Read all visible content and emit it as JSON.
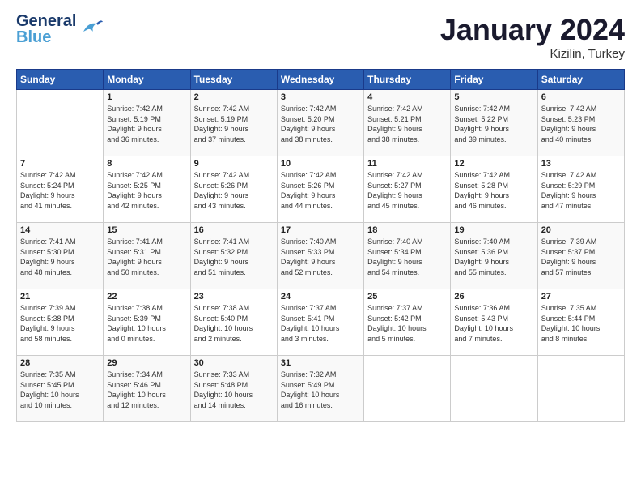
{
  "header": {
    "logo_general": "General",
    "logo_blue": "Blue",
    "month_title": "January 2024",
    "location": "Kizilin, Turkey"
  },
  "columns": [
    "Sunday",
    "Monday",
    "Tuesday",
    "Wednesday",
    "Thursday",
    "Friday",
    "Saturday"
  ],
  "weeks": [
    [
      {
        "day": "",
        "info": ""
      },
      {
        "day": "1",
        "info": "Sunrise: 7:42 AM\nSunset: 5:19 PM\nDaylight: 9 hours\nand 36 minutes."
      },
      {
        "day": "2",
        "info": "Sunrise: 7:42 AM\nSunset: 5:19 PM\nDaylight: 9 hours\nand 37 minutes."
      },
      {
        "day": "3",
        "info": "Sunrise: 7:42 AM\nSunset: 5:20 PM\nDaylight: 9 hours\nand 38 minutes."
      },
      {
        "day": "4",
        "info": "Sunrise: 7:42 AM\nSunset: 5:21 PM\nDaylight: 9 hours\nand 38 minutes."
      },
      {
        "day": "5",
        "info": "Sunrise: 7:42 AM\nSunset: 5:22 PM\nDaylight: 9 hours\nand 39 minutes."
      },
      {
        "day": "6",
        "info": "Sunrise: 7:42 AM\nSunset: 5:23 PM\nDaylight: 9 hours\nand 40 minutes."
      }
    ],
    [
      {
        "day": "7",
        "info": "Sunrise: 7:42 AM\nSunset: 5:24 PM\nDaylight: 9 hours\nand 41 minutes."
      },
      {
        "day": "8",
        "info": "Sunrise: 7:42 AM\nSunset: 5:25 PM\nDaylight: 9 hours\nand 42 minutes."
      },
      {
        "day": "9",
        "info": "Sunrise: 7:42 AM\nSunset: 5:26 PM\nDaylight: 9 hours\nand 43 minutes."
      },
      {
        "day": "10",
        "info": "Sunrise: 7:42 AM\nSunset: 5:26 PM\nDaylight: 9 hours\nand 44 minutes."
      },
      {
        "day": "11",
        "info": "Sunrise: 7:42 AM\nSunset: 5:27 PM\nDaylight: 9 hours\nand 45 minutes."
      },
      {
        "day": "12",
        "info": "Sunrise: 7:42 AM\nSunset: 5:28 PM\nDaylight: 9 hours\nand 46 minutes."
      },
      {
        "day": "13",
        "info": "Sunrise: 7:42 AM\nSunset: 5:29 PM\nDaylight: 9 hours\nand 47 minutes."
      }
    ],
    [
      {
        "day": "14",
        "info": "Sunrise: 7:41 AM\nSunset: 5:30 PM\nDaylight: 9 hours\nand 48 minutes."
      },
      {
        "day": "15",
        "info": "Sunrise: 7:41 AM\nSunset: 5:31 PM\nDaylight: 9 hours\nand 50 minutes."
      },
      {
        "day": "16",
        "info": "Sunrise: 7:41 AM\nSunset: 5:32 PM\nDaylight: 9 hours\nand 51 minutes."
      },
      {
        "day": "17",
        "info": "Sunrise: 7:40 AM\nSunset: 5:33 PM\nDaylight: 9 hours\nand 52 minutes."
      },
      {
        "day": "18",
        "info": "Sunrise: 7:40 AM\nSunset: 5:34 PM\nDaylight: 9 hours\nand 54 minutes."
      },
      {
        "day": "19",
        "info": "Sunrise: 7:40 AM\nSunset: 5:36 PM\nDaylight: 9 hours\nand 55 minutes."
      },
      {
        "day": "20",
        "info": "Sunrise: 7:39 AM\nSunset: 5:37 PM\nDaylight: 9 hours\nand 57 minutes."
      }
    ],
    [
      {
        "day": "21",
        "info": "Sunrise: 7:39 AM\nSunset: 5:38 PM\nDaylight: 9 hours\nand 58 minutes."
      },
      {
        "day": "22",
        "info": "Sunrise: 7:38 AM\nSunset: 5:39 PM\nDaylight: 10 hours\nand 0 minutes."
      },
      {
        "day": "23",
        "info": "Sunrise: 7:38 AM\nSunset: 5:40 PM\nDaylight: 10 hours\nand 2 minutes."
      },
      {
        "day": "24",
        "info": "Sunrise: 7:37 AM\nSunset: 5:41 PM\nDaylight: 10 hours\nand 3 minutes."
      },
      {
        "day": "25",
        "info": "Sunrise: 7:37 AM\nSunset: 5:42 PM\nDaylight: 10 hours\nand 5 minutes."
      },
      {
        "day": "26",
        "info": "Sunrise: 7:36 AM\nSunset: 5:43 PM\nDaylight: 10 hours\nand 7 minutes."
      },
      {
        "day": "27",
        "info": "Sunrise: 7:35 AM\nSunset: 5:44 PM\nDaylight: 10 hours\nand 8 minutes."
      }
    ],
    [
      {
        "day": "28",
        "info": "Sunrise: 7:35 AM\nSunset: 5:45 PM\nDaylight: 10 hours\nand 10 minutes."
      },
      {
        "day": "29",
        "info": "Sunrise: 7:34 AM\nSunset: 5:46 PM\nDaylight: 10 hours\nand 12 minutes."
      },
      {
        "day": "30",
        "info": "Sunrise: 7:33 AM\nSunset: 5:48 PM\nDaylight: 10 hours\nand 14 minutes."
      },
      {
        "day": "31",
        "info": "Sunrise: 7:32 AM\nSunset: 5:49 PM\nDaylight: 10 hours\nand 16 minutes."
      },
      {
        "day": "",
        "info": ""
      },
      {
        "day": "",
        "info": ""
      },
      {
        "day": "",
        "info": ""
      }
    ]
  ]
}
